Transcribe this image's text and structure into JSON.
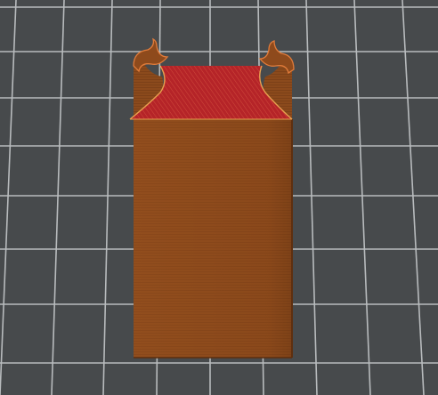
{
  "viewport": {
    "background_color": "#474a4c",
    "grid_color": "#b9bcbe",
    "model_body_color": "#8c4a1e",
    "model_top_color": "#b3262a",
    "model_highlight_color": "#e07b3a"
  }
}
